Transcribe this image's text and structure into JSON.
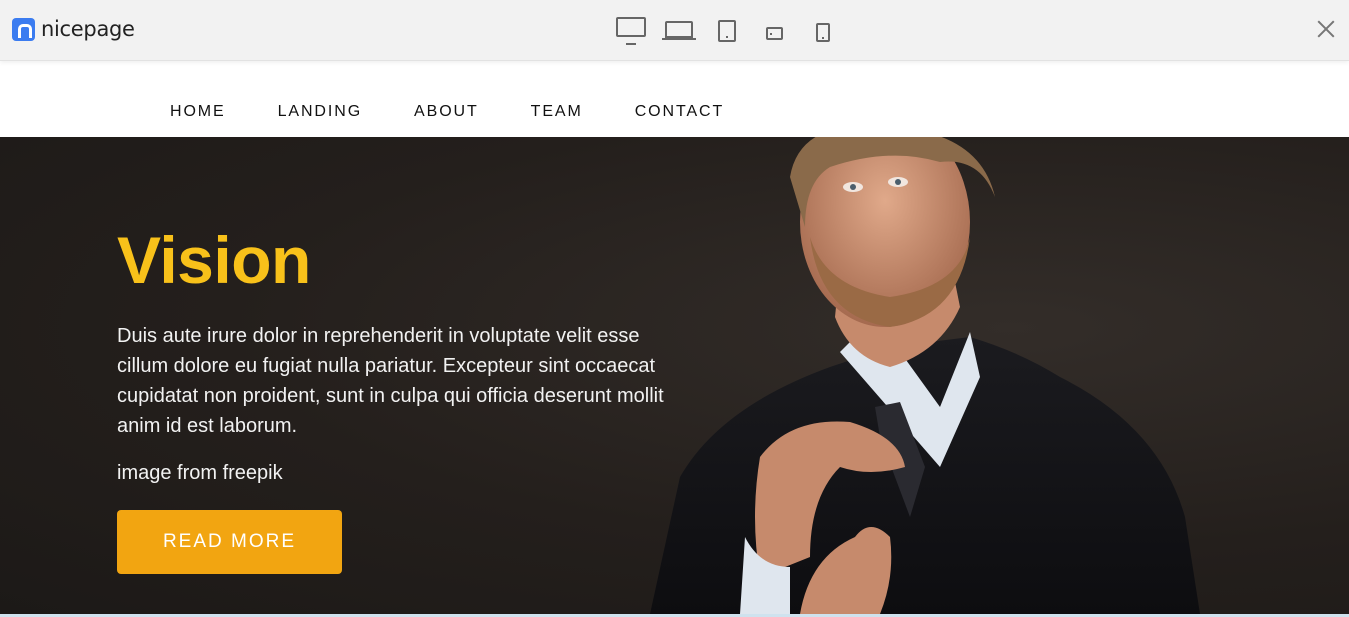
{
  "app": {
    "name": "nicepage"
  },
  "toolbar": {
    "devices": [
      {
        "name": "desktop-icon"
      },
      {
        "name": "laptop-icon"
      },
      {
        "name": "tablet-icon"
      },
      {
        "name": "phone-landscape-icon"
      },
      {
        "name": "phone-icon"
      }
    ],
    "close_icon": "close-icon"
  },
  "nav": {
    "items": [
      {
        "label": "HOME"
      },
      {
        "label": "LANDING"
      },
      {
        "label": "ABOUT"
      },
      {
        "label": "TEAM"
      },
      {
        "label": "CONTACT"
      }
    ]
  },
  "hero": {
    "title": "Vision",
    "text": "Duis aute irure dolor in reprehenderit in voluptate velit esse cillum dolore eu fugiat nulla pariatur. Excepteur sint occaecat cupidatat non proident, sunt in culpa qui officia deserunt mollit anim id est laborum.",
    "credit": "image from freepik",
    "button_label": "READ MORE"
  },
  "colors": {
    "accent": "#f8c11a",
    "button": "#f2a511",
    "hero_background": "#231f1d",
    "logo": "#3b7cf0"
  }
}
